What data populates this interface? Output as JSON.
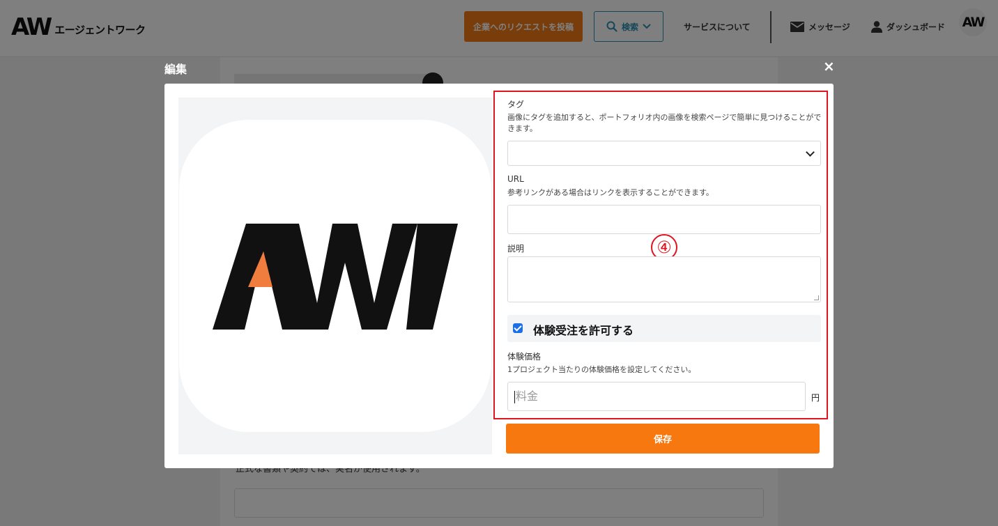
{
  "header": {
    "logo_mark": "AW",
    "logo_text": "エージェントワーク",
    "request_button": "企業へのリクエストを投稿",
    "search_button": "検索",
    "about": "サービスについて",
    "messages": "メッセージ",
    "dashboard": "ダッシュボード",
    "avatar": "AW"
  },
  "background": {
    "note": "正式な書類や契約では、実名が使用されます。"
  },
  "modal": {
    "title": "編集",
    "close": "×",
    "form": {
      "tag_label": "タグ",
      "tag_help": "画像にタグを追加すると、ポートフォリオ内の画像を検索ページで簡単に見つけることができます。",
      "url_label": "URL",
      "url_help": "参考リンクがある場合はリンクを表示することができます。",
      "description_label": "説明",
      "marker": "④",
      "trial_checkbox_label": "体験受注を許可する",
      "trial_checked": true,
      "price_label": "体験価格",
      "price_help": "1プロジェクト当たりの体験価格を設定してください。",
      "price_placeholder": "料金",
      "price_unit": "円"
    },
    "save_button": "保存"
  },
  "colors": {
    "brand_orange": "#f7780e",
    "highlight_red": "#e0141e",
    "search_blue": "#2b8fb0",
    "checkbox_blue": "#1d6fe6"
  }
}
